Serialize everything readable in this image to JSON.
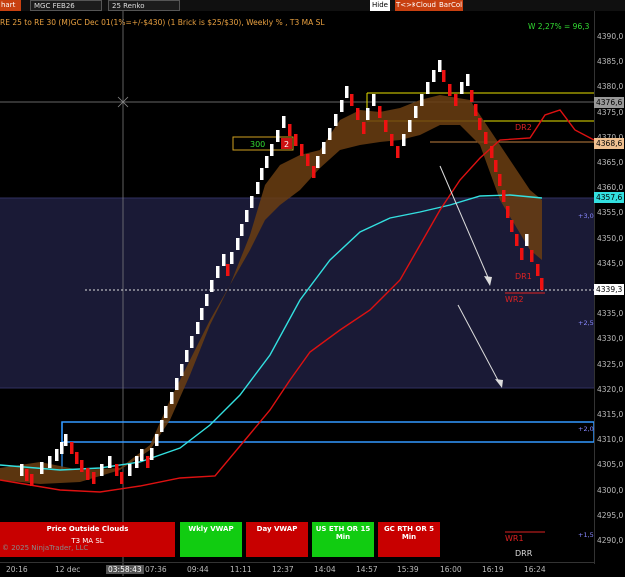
{
  "toolbar": {
    "chart_label": "hart",
    "instrument": "MGC FEB26",
    "bar_type": "25 Renko",
    "hide_button": "Hide",
    "tk_button": "T<>K",
    "cloud_button": "Cloud",
    "barcol_button": "BarCol"
  },
  "subtitle": "RE 25 to RE 30 (M)GC Dec 01(1%=+/-$430) (1 Brick is $25/$30), Weekly % , T3 MA SL",
  "stat_label": "W 2,27% = 96,3",
  "y_axis": [
    "4390,0",
    "4385,0",
    "4380,0",
    "4375,0",
    "4370,0",
    "4365,0",
    "4360,0",
    "4355,0",
    "4350,0",
    "4345,0",
    "4340,0",
    "4335,0",
    "4330,0",
    "4325,0",
    "4320,0",
    "4315,0",
    "4310,0",
    "4305,0",
    "4300,0",
    "4295,0",
    "4290,0"
  ],
  "price_tags": [
    {
      "text": "4376,6",
      "color": "#999999"
    },
    {
      "text": "4368,6",
      "color": "#f0c090"
    },
    {
      "text": "4357,6",
      "color": "#33e0e0"
    },
    {
      "text": "4339,3",
      "color": "#ffffff"
    }
  ],
  "sd_labels": [
    "+3,0",
    "+2,5",
    "+2,0",
    "+1,5"
  ],
  "level_labels": {
    "dr1": "DR1",
    "wr2": "WR2",
    "dr2": "DR2",
    "wr1": "WR1",
    "drr": "DRR"
  },
  "trade_box": {
    "qty": "300",
    "count": "2"
  },
  "x_axis": [
    "20:16",
    "12 dec",
    "03:58:43",
    "07:36",
    "09:44",
    "11:11",
    "12:37",
    "14:04",
    "14:57",
    "15:39",
    "16:00",
    "16:19",
    "16:24"
  ],
  "panels": {
    "price_outside": "Price Outside Clouds",
    "t3": "T3 MA SL",
    "copyright": "© 2025 NinjaTrader, LLC",
    "wkly_vwap": "Wkly VWAP",
    "day_vwap": "Day VWAP",
    "us_eth": "US ETH OR 15 Min",
    "gc_rth": "GC RTH OR 5 Min"
  }
}
